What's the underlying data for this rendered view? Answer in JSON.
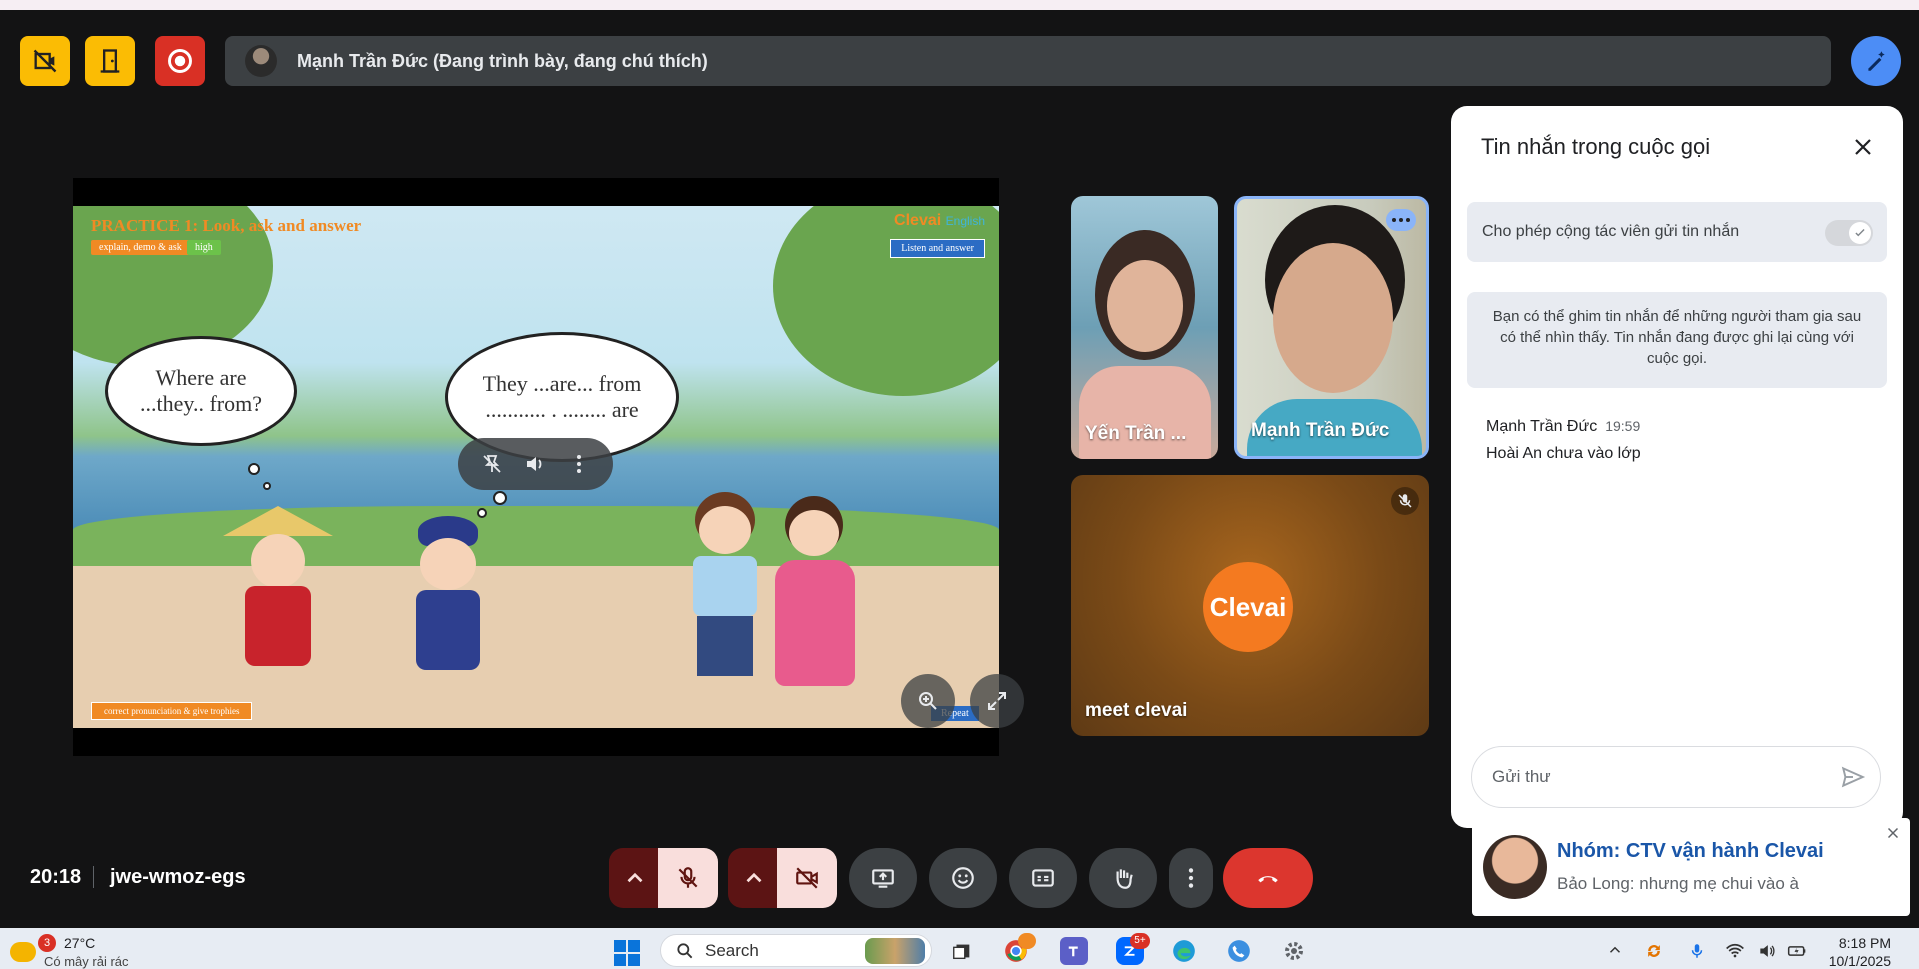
{
  "top_bar": {
    "presenter_text": "Mạnh Trần Đức (Đang trình bày, đang chú thích)",
    "buttons": [
      "camera-off-icon",
      "exit-icon",
      "record-icon"
    ],
    "accent_yellow": "#fbbc04",
    "accent_red": "#d93025"
  },
  "slide": {
    "title": "PRACTICE 1: Look, ask and answer",
    "tag_left": "explain, demo & ask",
    "tag_level": "high",
    "logo_main": "Clevai",
    "logo_sub": "English",
    "listen_label": "Listen and answer",
    "bubble1_line1": "Where  are",
    "bubble1_line2": "...they.. from?",
    "bubble2_line1": "They ...are... from",
    "bubble2_line2": "........... . ........ are",
    "bottom_tag": "correct pronunciation & give trophies",
    "repeat_label": "Repeat"
  },
  "participants": [
    {
      "name": "Yến Trần ..."
    },
    {
      "name": "Mạnh Trần Đức"
    },
    {
      "name": "meet clevai",
      "avatar_text": "Clevai"
    }
  ],
  "chat": {
    "title": "Tin nhắn trong cuộc gọi",
    "allow_label": "Cho phép cộng tác viên gửi tin nhắn",
    "allow_on": true,
    "info": "Bạn có thể ghim tin nhắn để những người tham gia sau có thể nhìn thấy. Tin nhắn đang được ghi lại cùng với cuộc gọi.",
    "messages": [
      {
        "sender": "Mạnh Trần Đức",
        "time": "19:59",
        "text": "Hoài An chưa vào lớp"
      }
    ],
    "input_placeholder": "Gửi thư"
  },
  "notification": {
    "title": "Nhóm: CTV vận hành Clevai",
    "message": "Bảo Long: nhưng mẹ chui vào à"
  },
  "bottom": {
    "time": "20:18",
    "meeting_code": "jwe-wmoz-egs",
    "end_color": "#dc362e"
  },
  "taskbar": {
    "weather_badge": "3",
    "temperature": "27°C",
    "condition": "Có mây rải rác",
    "search_label": "Search",
    "zalo_badge": "5+",
    "clock_time": "8:18 PM",
    "clock_date": "10/1/2025"
  }
}
